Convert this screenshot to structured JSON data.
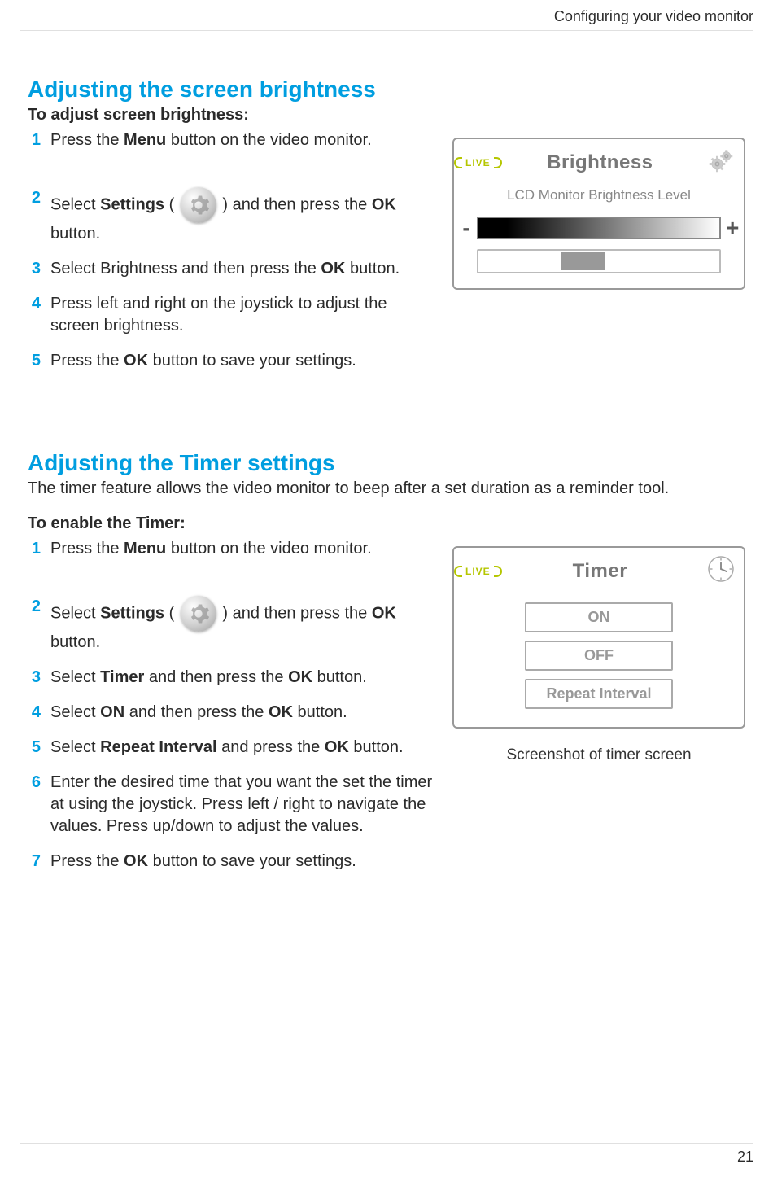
{
  "header": {
    "breadcrumb": "Configuring your video monitor"
  },
  "section1": {
    "title": "Adjusting the screen brightness",
    "subhead": "To adjust screen brightness:",
    "steps": {
      "s1_a": "Press the ",
      "s1_b": "Menu",
      "s1_c": " button on the video monitor.",
      "s2_a": "Select ",
      "s2_b": "Settings",
      "s2_c": " ( ",
      "s2_d": " ) and then press the ",
      "s2_e": "OK",
      "s2_f": " button.",
      "s3_a": "Select Brightness and then press the ",
      "s3_b": "OK",
      "s3_c": " button.",
      "s4": "Press left and right on the joystick to adjust the screen brightness.",
      "s5_a": "Press the ",
      "s5_b": "OK",
      "s5_c": " button to save your settings."
    },
    "ui": {
      "live": "LIVE",
      "title": "Brightness",
      "subtitle": "LCD Monitor Brightness Level",
      "minus": "-",
      "plus": "+"
    }
  },
  "section2": {
    "title": "Adjusting the Timer settings",
    "intro": "The timer feature allows the video monitor to beep after a set duration as a reminder tool.",
    "subhead": "To enable the Timer:",
    "steps": {
      "s1_a": "Press the ",
      "s1_b": "Menu",
      "s1_c": " button on the video monitor.",
      "s2_a": "Select ",
      "s2_b": "Settings",
      "s2_c": " ( ",
      "s2_d": " ) and then press the ",
      "s2_e": "OK",
      "s2_f": " button.",
      "s3_a": "Select ",
      "s3_b": "Timer",
      "s3_c": " and then press the ",
      "s3_d": "OK",
      "s3_e": " button.",
      "s4_a": "Select ",
      "s4_b": "ON",
      "s4_c": " and then press the ",
      "s4_d": "OK",
      "s4_e": " button.",
      "s5_a": "Select ",
      "s5_b": "Repeat Interval",
      "s5_c": " and press the ",
      "s5_d": "OK",
      "s5_e": " button.",
      "s6": "Enter the desired time that you want the set the timer at using the joystick. Press left / right to navigate the values. Press up/down to adjust the values.",
      "s7_a": "Press the ",
      "s7_b": "OK",
      "s7_c": " button to save your settings."
    },
    "ui": {
      "live": "LIVE",
      "title": "Timer",
      "on": "ON",
      "off": "OFF",
      "repeat": "Repeat Interval"
    },
    "caption": "Screenshot of timer screen"
  },
  "footer": {
    "page": "21"
  }
}
